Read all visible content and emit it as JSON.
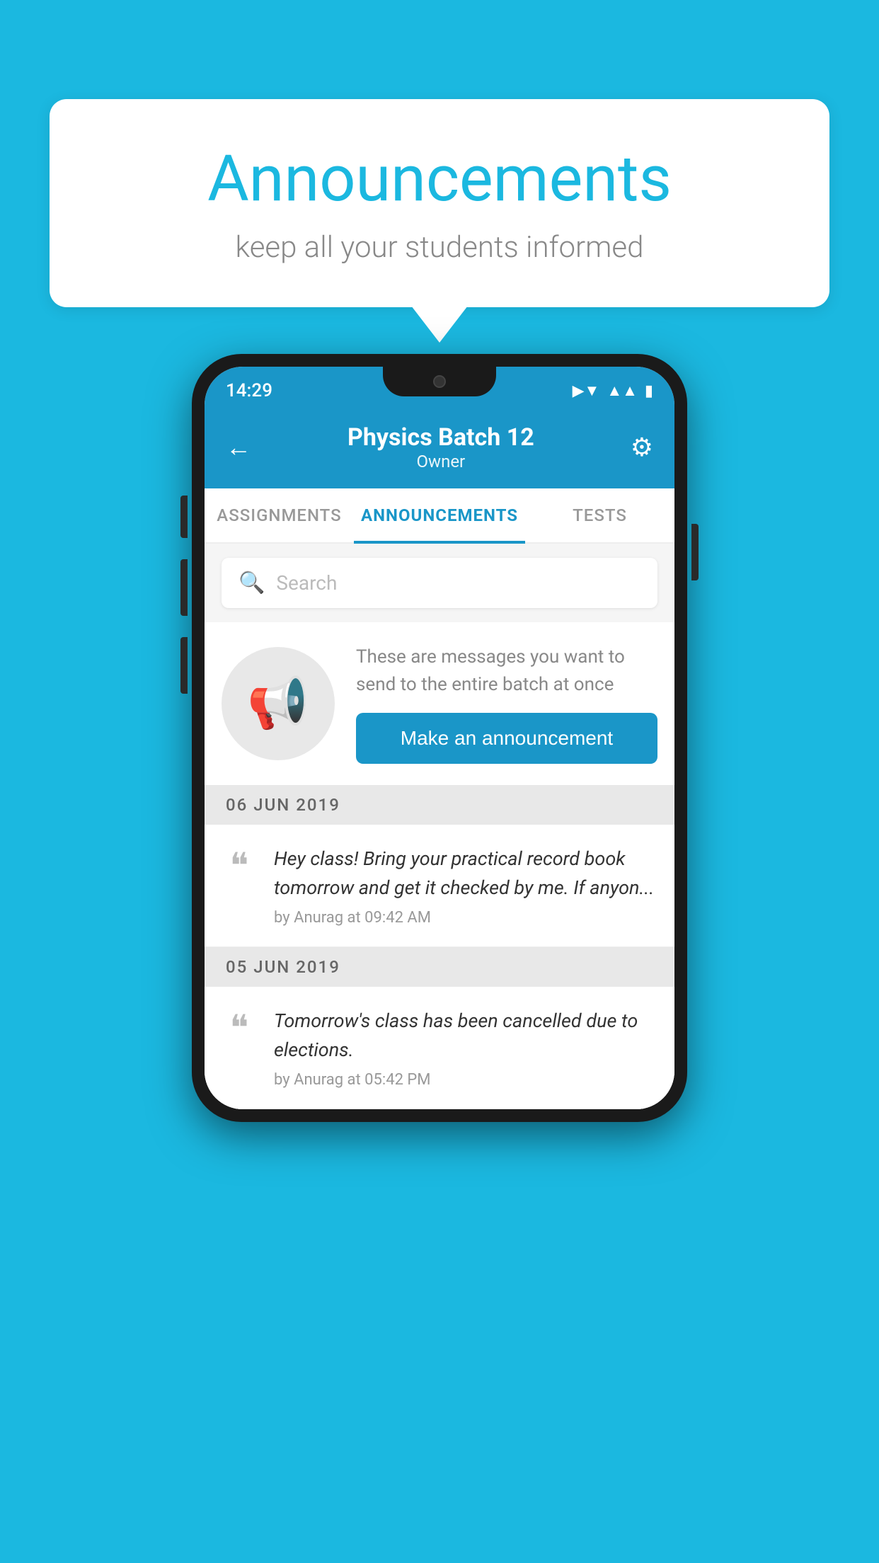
{
  "background_color": "#1bb8e0",
  "speech_bubble": {
    "title": "Announcements",
    "subtitle": "keep all your students informed"
  },
  "phone": {
    "status_bar": {
      "time": "14:29",
      "wifi": "▾",
      "signal": "▾",
      "battery": "▾"
    },
    "header": {
      "title": "Physics Batch 12",
      "subtitle": "Owner",
      "back_label": "←",
      "settings_label": "⚙"
    },
    "tabs": [
      {
        "label": "ASSIGNMENTS",
        "active": false
      },
      {
        "label": "ANNOUNCEMENTS",
        "active": true
      },
      {
        "label": "TESTS",
        "active": false
      }
    ],
    "search": {
      "placeholder": "Search"
    },
    "promo": {
      "description": "These are messages you want to send to the entire batch at once",
      "button_label": "Make an announcement"
    },
    "announcements": [
      {
        "date": "06  JUN  2019",
        "items": [
          {
            "text": "Hey class! Bring your practical record book tomorrow and get it checked by me. If anyon...",
            "meta": "by Anurag at 09:42 AM"
          }
        ]
      },
      {
        "date": "05  JUN  2019",
        "items": [
          {
            "text": "Tomorrow's class has been cancelled due to elections.",
            "meta": "by Anurag at 05:42 PM"
          }
        ]
      }
    ]
  }
}
